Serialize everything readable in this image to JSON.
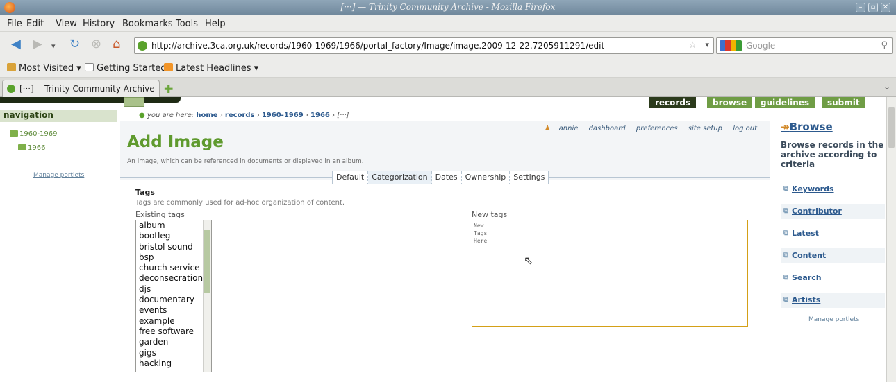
{
  "window": {
    "title": "[···] — Trinity Community Archive - Mozilla Firefox",
    "buttons": [
      "–",
      "▫",
      "✕"
    ]
  },
  "menubar": {
    "items": [
      "File",
      "Edit",
      "View",
      "History",
      "Bookmarks",
      "Tools",
      "Help"
    ]
  },
  "toolbar": {
    "url": "http://archive.3ca.org.uk/records/1960-1969/1966/portal_factory/Image/image.2009-12-22.7205911291/edit",
    "search_placeholder": "Google"
  },
  "bookmarks": {
    "items": [
      "Most Visited",
      "Getting Started",
      "Latest Headlines"
    ]
  },
  "tabs": {
    "active": {
      "prefix": "[···]",
      "label": "Trinity Community Archive"
    }
  },
  "site": {
    "global_nav": [
      "records",
      "browse",
      "guidelines",
      "submit"
    ],
    "active_nav": "records",
    "navigation_title": "navigation",
    "nav_items": [
      "1960-1969",
      "1966"
    ],
    "manage_portlets": "Manage portlets",
    "breadcrumb": {
      "prefix": "you are here:",
      "items": [
        "home",
        "records",
        "1960-1969",
        "1966"
      ],
      "current": "[···]"
    },
    "personal_bar": [
      "annie",
      "dashboard",
      "preferences",
      "site setup",
      "log out"
    ],
    "page_title": "Add Image",
    "page_description": "An image, which can be referenced in documents or displayed in an album.",
    "form_tabs": [
      "Default",
      "Categorization",
      "Dates",
      "Ownership",
      "Settings"
    ],
    "selected_form_tab": "Categorization",
    "tags": {
      "heading": "Tags",
      "help": "Tags are commonly used for ad-hoc organization of content.",
      "existing_label": "Existing tags",
      "existing": [
        "album",
        "bootleg",
        "bristol sound",
        "bsp",
        "church service",
        "deconsecration",
        "djs",
        "documentary",
        "events",
        "example",
        "free software",
        "garden",
        "gigs",
        "hacking"
      ],
      "new_label": "New tags",
      "new_value": "New\nTags\nHere"
    },
    "browse_portlet": {
      "title": "Browse",
      "description": "Browse records in the archive according to criteria",
      "items": [
        "Keywords",
        "Contributor",
        "Latest",
        "Content",
        "Search",
        "Artists"
      ]
    }
  }
}
